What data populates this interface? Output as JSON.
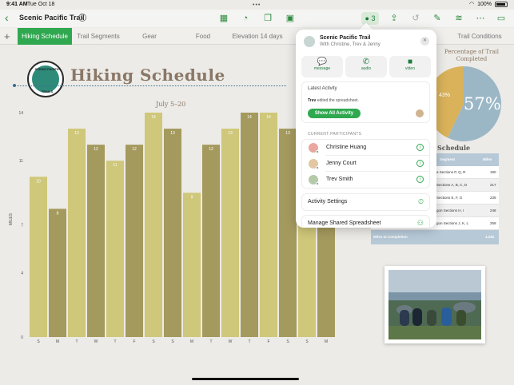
{
  "status": {
    "time": "9:41 AM",
    "date": "Tue Oct 18",
    "battery": "100%"
  },
  "toolbar": {
    "back": "‹",
    "title": "Scenic Pacific Trail",
    "collab_count": "3",
    "dots": "•••",
    "icons": [
      "table-icon",
      "chart-icon",
      "shapes-icon",
      "media-icon",
      "collaborate-icon",
      "share-icon",
      "undo-icon",
      "format-brush-icon",
      "format-icon",
      "more-icon"
    ]
  },
  "tabs": [
    {
      "label": "Hiking Schedule",
      "active": true
    },
    {
      "label": "Trail Segments"
    },
    {
      "label": "Gear"
    },
    {
      "label": "Food"
    },
    {
      "label": "Elevation 14 days"
    },
    {
      "label": "Trail Conditions"
    }
  ],
  "sheet": {
    "logo_top": "SCENIC",
    "logo_right": "PACIFIC",
    "logo_bottom": "TRAILS",
    "title": "Hiking Schedule",
    "subtitle": "July 5–20",
    "ylabel": "MILES"
  },
  "chart_data": {
    "type": "bar",
    "categories": [
      "S",
      "M",
      "T",
      "W",
      "T",
      "F",
      "S",
      "S",
      "M",
      "T",
      "W",
      "T",
      "F",
      "S",
      "S",
      "M"
    ],
    "values": [
      10,
      8,
      13,
      12,
      11,
      12,
      14,
      13,
      9,
      12,
      13,
      14,
      14,
      13,
      12,
      11
    ],
    "ylim": [
      0,
      14
    ],
    "yticks": [
      0,
      4,
      7,
      11,
      14
    ],
    "xlabel": "",
    "ylabel": "MILES",
    "colors": {
      "light": "#cfc77a",
      "dark": "#a59a5e"
    }
  },
  "popover": {
    "title": "Scenic Pacific Trail",
    "subtitle": "With Christine, Trev & Jenny",
    "buttons": [
      {
        "label": "message",
        "icon": "message-icon"
      },
      {
        "label": "audio",
        "icon": "phone-icon"
      },
      {
        "label": "video",
        "icon": "video-icon"
      }
    ],
    "latest_activity": {
      "header": "Latest Activity",
      "who": "Trev",
      "text": "edited the spreadsheet.",
      "button": "Show All Activity"
    },
    "participants_header": "CURRENT PARTICIPANTS",
    "participants": [
      {
        "name": "Christine Huang",
        "color": "#e9a7a0",
        "status": "#2fa84f"
      },
      {
        "name": "Jenny Court",
        "color": "#e2c7a2",
        "status": "#9b59b6"
      },
      {
        "name": "Trev Smith",
        "color": "#b6c9a8",
        "status": "#3b8ad9"
      }
    ],
    "settings": [
      "Activity Settings",
      "Manage Shared Spreadsheet"
    ]
  },
  "pie": {
    "title": "Percentage of Trail Completed",
    "big": "57%",
    "small": "43%",
    "values": [
      57,
      43
    ],
    "colors": {
      "done": "#9bb7c6",
      "left": "#d9b25a"
    }
  },
  "schedule": {
    "title": "Schedule",
    "headers": [
      "Segment",
      "Miles"
    ],
    "rows": [
      {
        "seg": "a Sections P, Q, R",
        "miles": "190"
      },
      {
        "seg": "Sections A, B, C, D",
        "miles": "217"
      },
      {
        "seg": "Sections E, F, G",
        "miles": "239"
      },
      {
        "seg": "gon Sections H, I",
        "miles": "248"
      },
      {
        "seg": "gon Sections J, K, L",
        "miles": "258"
      }
    ],
    "footer": "Miles to Completion",
    "footer_value": "1,152"
  }
}
